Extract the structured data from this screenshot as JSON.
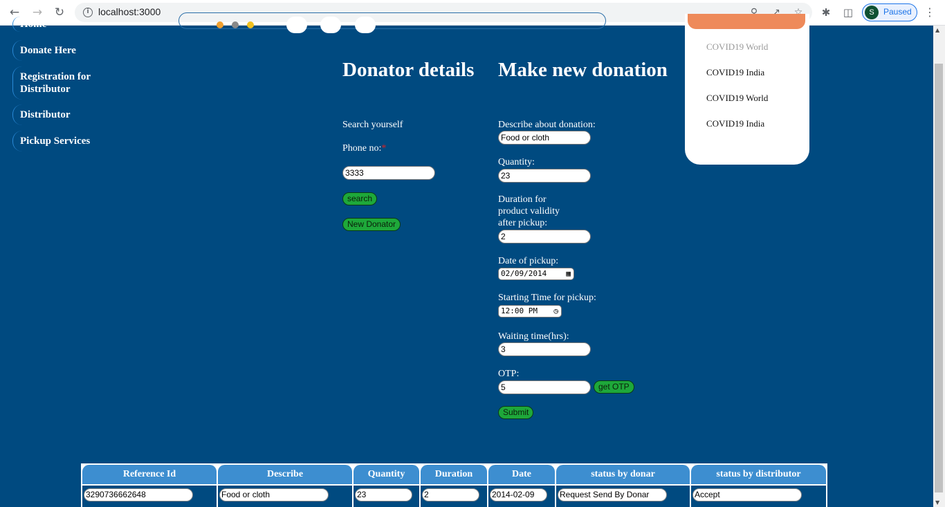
{
  "browser": {
    "url": "localhost:3000",
    "profile_initial": "S",
    "profile_status": "Paused"
  },
  "sidebar": {
    "items": [
      {
        "label": "Home"
      },
      {
        "label": "Donate Here"
      },
      {
        "label": "Registration for Distributor"
      },
      {
        "label": "Distributor"
      },
      {
        "label": "Pickup Services"
      }
    ]
  },
  "donator": {
    "title": "Donator details",
    "search_label": "Search yourself",
    "phone_label": "Phone no:",
    "required_mark": "*",
    "phone_value": "3333",
    "search_button": "search",
    "new_button": "New Donator"
  },
  "donation": {
    "title": "Make new donation",
    "describe_label": "Describe about donation:",
    "describe_value": "Food or cloth",
    "quantity_label": "Quantity:",
    "quantity_value": "23",
    "duration_label_1": "Duration for",
    "duration_label_2": "product validity",
    "duration_label_3": "after pickup:",
    "duration_value": "2",
    "date_label": "Date of pickup:",
    "date_value": "02/09/2014",
    "time_label": "Starting Time for pickup:",
    "time_value": "12:00 PM",
    "waiting_label": "Waiting time(hrs):",
    "waiting_value": "3",
    "otp_label": "OTP:",
    "otp_value": "5",
    "otp_button": "get OTP",
    "submit_button": "Submit"
  },
  "news": {
    "items": [
      {
        "label": "COVID19 World"
      },
      {
        "label": "COVID19 India"
      },
      {
        "label": "COVID19 World"
      },
      {
        "label": "COVID19 India"
      }
    ]
  },
  "table": {
    "headers": [
      "Reference Id",
      "Describe",
      "Quantity",
      "Duration",
      "Date",
      "status by donar",
      "status by distributor"
    ],
    "row": [
      "3290736662648",
      "Food or cloth",
      "23",
      "2",
      "2014-02-09",
      "Request Send By Donar",
      "Accept"
    ]
  },
  "colors": {
    "page_bg": "#004a80",
    "button_green": "#1ea83a",
    "header_blue": "#3d8ed0",
    "card_accent": "#ee8a5a"
  }
}
